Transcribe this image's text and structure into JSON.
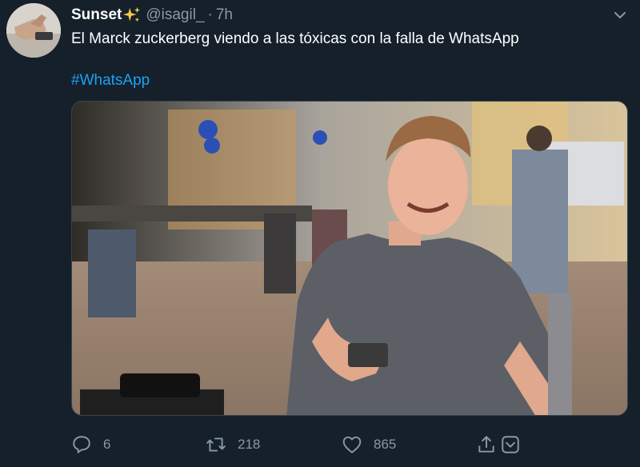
{
  "tweet": {
    "author": {
      "display_name": "Sunset",
      "handle": "@isagil_",
      "separator": "·",
      "time": "7h"
    },
    "text": "El Marck zuckerberg viendo a las tóxicas con la falla de WhatsApp",
    "hashtag": "#WhatsApp",
    "media": {
      "description_icon": "photo-icon"
    },
    "actions": {
      "reply_count": "6",
      "retweet_count": "218",
      "like_count": "865"
    }
  },
  "colors": {
    "background": "#15202b",
    "secondary_text": "#8899a6",
    "link": "#1da1f2",
    "border": "#38444d"
  }
}
